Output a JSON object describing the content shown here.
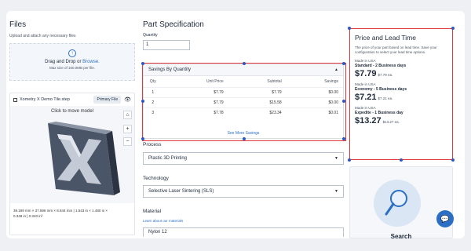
{
  "files": {
    "title": "Files",
    "subtitle": "Upload and attach any necessary files",
    "drop_text": "Drag and Drop or",
    "browse_link": "Browse.",
    "max_size": "Max size of 100.0MB per file.",
    "file_name": "Xometry X Demo Tile.step",
    "primary_label": "Primary File",
    "viewer_hint": "Click to move model",
    "dims_line1": "39.189 mm × 37.596 mm × 8.844 mm  |  1.543 in × 1.480 in ×",
    "dims_line2": "0.348 in  |  0.340 in³"
  },
  "spec": {
    "title": "Part Specification",
    "quantity_label": "Quantity",
    "quantity_value": "1",
    "savings": {
      "header": "Savings By Quantity",
      "columns": [
        "Qty",
        "Unit Price",
        "Subtotal",
        "Savings"
      ],
      "rows": [
        [
          "1",
          "$7.79",
          "$7.79",
          "$0.00"
        ],
        [
          "2",
          "$7.79",
          "$15.58",
          "$0.00"
        ],
        [
          "3",
          "$7.78",
          "$23.34",
          "$0.01"
        ]
      ],
      "more": "See More Savings"
    },
    "process_label": "Process",
    "process_value": "Plastic 3D Printing",
    "technology_label": "Technology",
    "technology_value": "Selective Laser Sintering (SLS)",
    "material_label": "Material",
    "learn_link": "Learn about our materials",
    "material_value": "Nylon 12"
  },
  "price": {
    "title": "Price and Lead Time",
    "description": "The price of your part based on lead time. Save your configuration to select your lead time options.",
    "options": [
      {
        "made": "Made in USA",
        "speed": "Standard - 2 Business days",
        "price": "$7.79",
        "each": "$7.79 ea."
      },
      {
        "made": "Made in USA",
        "speed": "Economy - 5 Business days",
        "price": "$7.21",
        "each": "$7.21 ea."
      },
      {
        "made": "Made in USA",
        "speed": "Expedite - 1 Business day",
        "price": "$13.27",
        "each": "$13.27 ea."
      }
    ]
  },
  "search_card": {
    "label": "Search"
  },
  "colors": {
    "accent": "#2b6fc5",
    "highlight": "#e4363d",
    "handle": "#2b58c5"
  }
}
